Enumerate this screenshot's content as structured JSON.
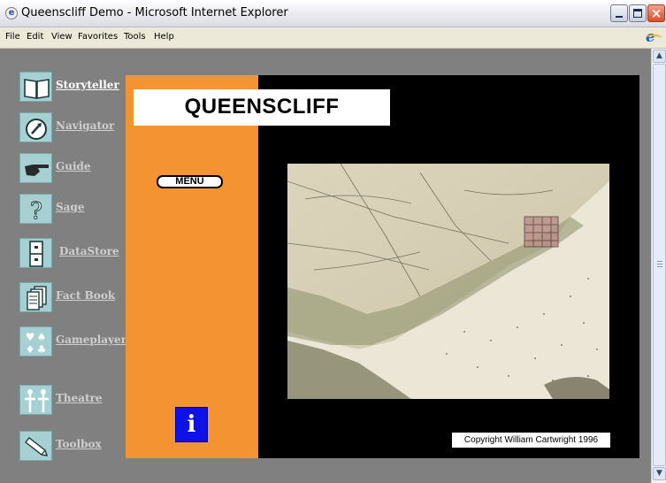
{
  "window": {
    "title": "Queenscliff Demo - Microsoft Internet Explorer",
    "icon": "ie-page-icon",
    "controls": {
      "minimize": "minimize-icon",
      "maximize": "maximize-icon",
      "close": "×"
    }
  },
  "menubar": {
    "items": [
      "File",
      "Edit",
      "View",
      "Favorites",
      "Tools",
      "Help"
    ]
  },
  "scrollbar": {
    "up": "▲",
    "down": "▼"
  },
  "sidebar": {
    "items": [
      {
        "label": "Storyteller",
        "icon": "book-icon"
      },
      {
        "label": "Navigator",
        "icon": "compass-icon"
      },
      {
        "label": "Guide",
        "icon": "pointing-hand-icon"
      },
      {
        "label": "Sage",
        "icon": "question-mark-icon"
      },
      {
        "label": "DataStore",
        "icon": "filing-cabinet-icon"
      },
      {
        "label": "Fact Book",
        "icon": "stacked-pages-icon"
      },
      {
        "label": "Gameplayer",
        "icon": "card-suits-icon"
      },
      {
        "label": "Theatre",
        "icon": "figures-icon"
      },
      {
        "label": "Toolbox",
        "icon": "pencil-icon"
      }
    ]
  },
  "main": {
    "title": "QUEENSCLIFF",
    "menu_button": "MENU",
    "info_button": "i",
    "map_image": "historic-map-of-queenscliff",
    "copyright": "Copyright William Cartwright 1996"
  },
  "colors": {
    "page_background": "#808080",
    "orange_panel": "#f39332",
    "black_panel": "#000000",
    "info_button": "#1010e8",
    "sidebar_icon_tile": "#a6d0d2"
  }
}
